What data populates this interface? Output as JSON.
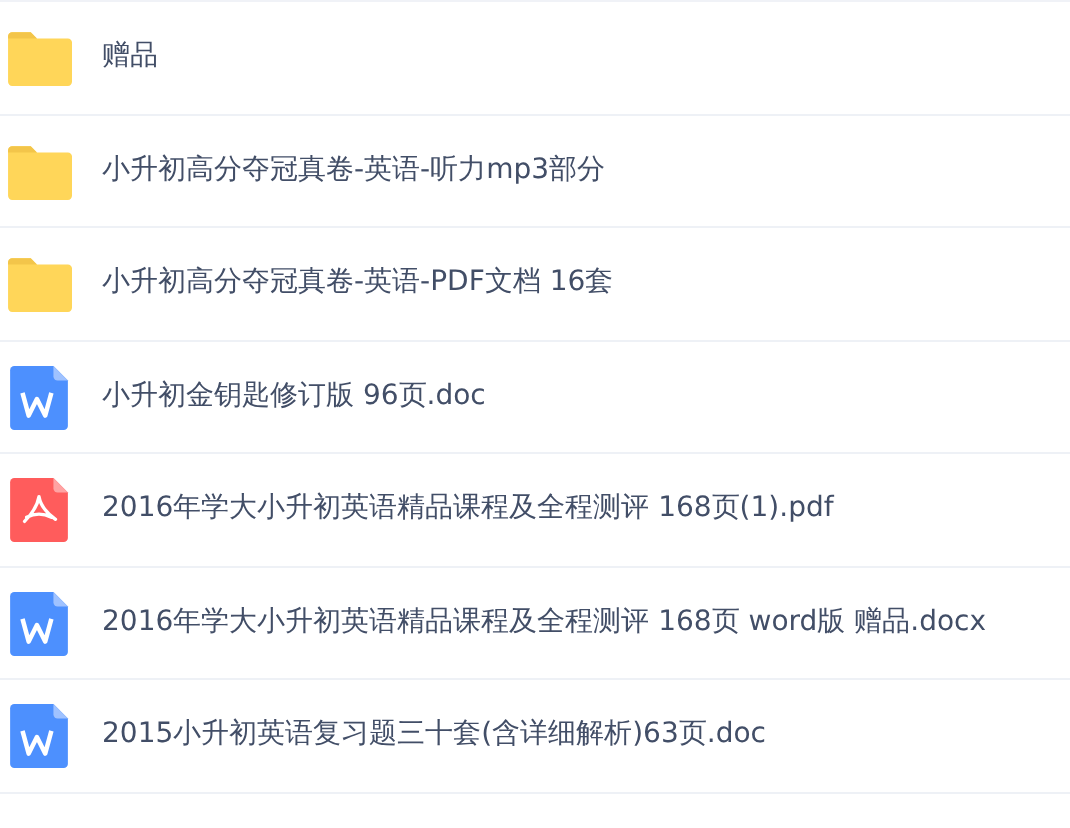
{
  "files": [
    {
      "kind": "folder",
      "name": "赠品"
    },
    {
      "kind": "folder",
      "name": "小升初高分夺冠真卷-英语-听力mp3部分"
    },
    {
      "kind": "folder",
      "name": "小升初高分夺冠真卷-英语-PDF文档 16套"
    },
    {
      "kind": "word",
      "name": "小升初金钥匙修订版 96页.doc"
    },
    {
      "kind": "pdf",
      "name": "2016年学大小升初英语精品课程及全程测评 168页(1).pdf"
    },
    {
      "kind": "word",
      "name": "2016年学大小升初英语精品课程及全程测评 168页 word版 赠品.docx"
    },
    {
      "kind": "word",
      "name": "2015小升初英语复习题三十套(含详细解析)63页.doc"
    }
  ]
}
